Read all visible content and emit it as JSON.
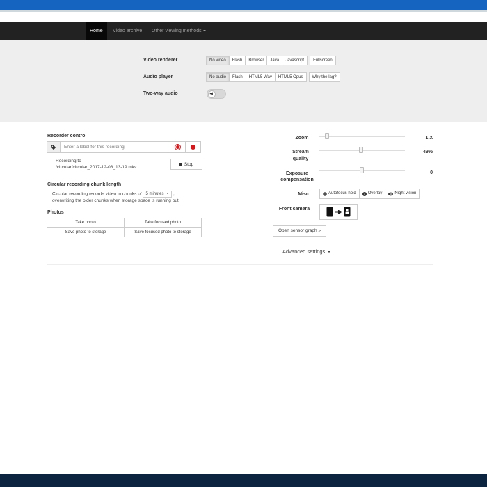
{
  "nav": {
    "home": "Home",
    "archive": "Video archive",
    "other": "Other viewing methods"
  },
  "settings": {
    "video_renderer": {
      "label": "Video renderer",
      "options": [
        "No video",
        "Flash",
        "Browser",
        "Java",
        "Javascript",
        "Fullscreen"
      ],
      "selected": "No video"
    },
    "audio_player": {
      "label": "Audio player",
      "options": [
        "No audio",
        "Flash",
        "HTML5 Wav",
        "HTML5 Opus",
        "Why the lag?"
      ],
      "selected": "No audio"
    },
    "two_way_audio": {
      "label": "Two-way audio"
    }
  },
  "recorder": {
    "title": "Recorder control",
    "placeholder": "Enter a label for this recording",
    "recording_to_line1": "Recording to",
    "recording_to_line2": "/circular/circular_2017-12-08_13-19.mkv",
    "stop_label": "Stop"
  },
  "circular": {
    "title": "Circular recording chunk length",
    "text_before": "Circular recording records video in chunks of",
    "chunk_value": "5 minutes",
    "text_after": ",",
    "text_line2": "overwriting the older chunks when storage space is running out."
  },
  "photos": {
    "title": "Photos",
    "take_photo": "Take photo",
    "take_focused": "Take focused photo",
    "save_photo": "Save photo to storage",
    "save_focused": "Save focused photo to storage"
  },
  "controls": {
    "zoom": {
      "label": "Zoom",
      "value": "1 X",
      "level": 0.08
    },
    "stream_quality": {
      "label_line1": "Stream",
      "label_line2": "quality",
      "value": "49%",
      "level": 0.49
    },
    "exposure": {
      "label_line1": "Exposure",
      "label_line2": "compensation",
      "value": "0",
      "level": 0.5
    },
    "misc": {
      "label": "Misc",
      "autofocus": "Autofocus hold",
      "overlay": "Overlay",
      "night_vision": "Night vision"
    },
    "front_camera": {
      "label": "Front camera"
    },
    "sensor_graph": "Open sensor graph »",
    "advanced": "Advanced settings"
  },
  "icons": [
    "tag-icon",
    "record-icon",
    "stop-icon",
    "crosshair-icon",
    "info-icon",
    "eye-icon",
    "microphone-icon",
    "phone-icon",
    "arrow-right-icon",
    "caret-down-icon"
  ]
}
